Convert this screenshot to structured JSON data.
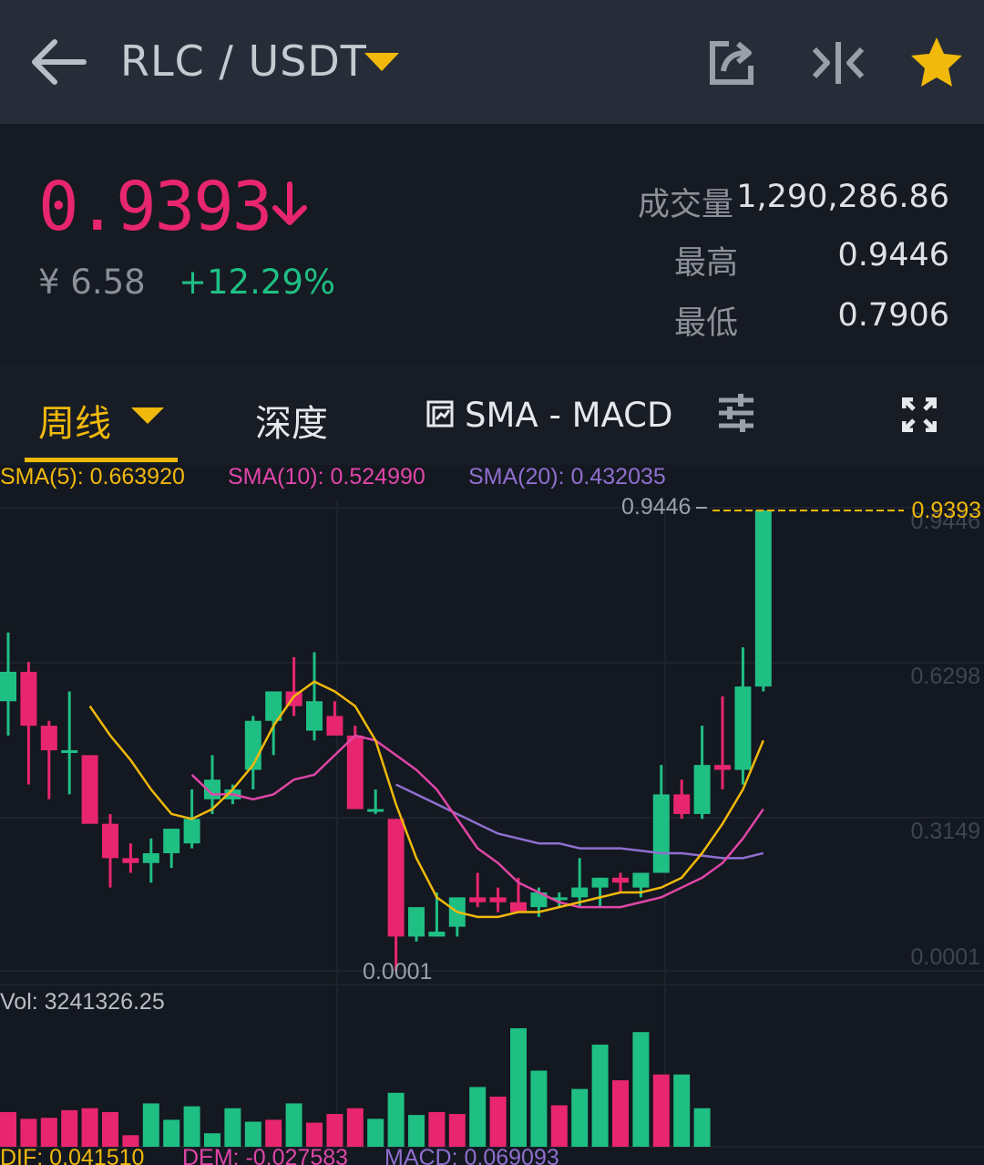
{
  "header": {
    "pair": "RLC / USDT",
    "icons": [
      "back-arrow-icon",
      "caret-down-icon",
      "share-icon",
      "compare-icon",
      "star-icon"
    ]
  },
  "ticker": {
    "price": "0.9393",
    "cny": "¥ 6.58",
    "change": "+12.29%",
    "volume_label": "成交量",
    "volume_value": "1,290,286.86",
    "high_label": "最高",
    "high_value": "0.9446",
    "low_label": "最低",
    "low_value": "0.7906"
  },
  "tabs": {
    "period": "周线",
    "depth": "深度",
    "indicator": "SMA - MACD"
  },
  "colors": {
    "up": "#1fbf84",
    "down": "#e8266f",
    "accent": "#f0b90b",
    "sma5": "#f0b90b",
    "sma10": "#e046a8",
    "sma20": "#8f6fcf"
  },
  "chart_data": {
    "type": "candlestick",
    "legend": {
      "sma5": "SMA(5): 0.663920",
      "sma10": "SMA(10): 0.524990",
      "sma20": "SMA(20): 0.432035"
    },
    "y_ticks": [
      "0.9446",
      "0.6298",
      "0.3149",
      "0.0001"
    ],
    "ylim": [
      0.0001,
      0.9446
    ],
    "max_label": "0.9446",
    "min_label": "0.0001",
    "last_price_label": "0.9393",
    "candles": [
      {
        "o": 0.55,
        "h": 0.69,
        "l": 0.48,
        "c": 0.61
      },
      {
        "o": 0.61,
        "h": 0.63,
        "l": 0.38,
        "c": 0.5
      },
      {
        "o": 0.5,
        "h": 0.51,
        "l": 0.35,
        "c": 0.45
      },
      {
        "o": 0.45,
        "h": 0.57,
        "l": 0.36,
        "c": 0.45
      },
      {
        "o": 0.44,
        "h": 0.44,
        "l": 0.32,
        "c": 0.3
      },
      {
        "o": 0.3,
        "h": 0.32,
        "l": 0.17,
        "c": 0.23
      },
      {
        "o": 0.23,
        "h": 0.26,
        "l": 0.2,
        "c": 0.22
      },
      {
        "o": 0.22,
        "h": 0.27,
        "l": 0.18,
        "c": 0.24
      },
      {
        "o": 0.24,
        "h": 0.29,
        "l": 0.21,
        "c": 0.29
      },
      {
        "o": 0.26,
        "h": 0.37,
        "l": 0.25,
        "c": 0.31
      },
      {
        "o": 0.35,
        "h": 0.44,
        "l": 0.32,
        "c": 0.39
      },
      {
        "o": 0.35,
        "h": 0.38,
        "l": 0.34,
        "c": 0.37
      },
      {
        "o": 0.41,
        "h": 0.52,
        "l": 0.37,
        "c": 0.51
      },
      {
        "o": 0.51,
        "h": 0.57,
        "l": 0.44,
        "c": 0.57
      },
      {
        "o": 0.57,
        "h": 0.64,
        "l": 0.52,
        "c": 0.54
      },
      {
        "o": 0.49,
        "h": 0.65,
        "l": 0.47,
        "c": 0.55
      },
      {
        "o": 0.52,
        "h": 0.55,
        "l": 0.48,
        "c": 0.48
      },
      {
        "o": 0.48,
        "h": 0.5,
        "l": 0.34,
        "c": 0.33
      },
      {
        "o": 0.33,
        "h": 0.37,
        "l": 0.32,
        "c": 0.33
      },
      {
        "o": 0.31,
        "h": 0.31,
        "l": 0.0001,
        "c": 0.07
      },
      {
        "o": 0.07,
        "h": 0.12,
        "l": 0.06,
        "c": 0.13
      },
      {
        "o": 0.07,
        "h": 0.16,
        "l": 0.07,
        "c": 0.08
      },
      {
        "o": 0.09,
        "h": 0.15,
        "l": 0.07,
        "c": 0.15
      },
      {
        "o": 0.15,
        "h": 0.2,
        "l": 0.13,
        "c": 0.14
      },
      {
        "o": 0.15,
        "h": 0.17,
        "l": 0.12,
        "c": 0.14
      },
      {
        "o": 0.14,
        "h": 0.19,
        "l": 0.13,
        "c": 0.12
      },
      {
        "o": 0.13,
        "h": 0.17,
        "l": 0.11,
        "c": 0.16
      },
      {
        "o": 0.15,
        "h": 0.16,
        "l": 0.13,
        "c": 0.15
      },
      {
        "o": 0.15,
        "h": 0.23,
        "l": 0.13,
        "c": 0.17
      },
      {
        "o": 0.17,
        "h": 0.19,
        "l": 0.13,
        "c": 0.19
      },
      {
        "o": 0.19,
        "h": 0.2,
        "l": 0.16,
        "c": 0.18
      },
      {
        "o": 0.17,
        "h": 0.2,
        "l": 0.15,
        "c": 0.2
      },
      {
        "o": 0.2,
        "h": 0.42,
        "l": 0.2,
        "c": 0.36
      },
      {
        "o": 0.36,
        "h": 0.39,
        "l": 0.31,
        "c": 0.32
      },
      {
        "o": 0.32,
        "h": 0.5,
        "l": 0.31,
        "c": 0.42
      },
      {
        "o": 0.42,
        "h": 0.56,
        "l": 0.37,
        "c": 0.41
      },
      {
        "o": 0.41,
        "h": 0.66,
        "l": 0.38,
        "c": 0.58
      },
      {
        "o": 0.58,
        "h": 0.94,
        "l": 0.57,
        "c": 0.9393
      }
    ],
    "sma5": [
      null,
      null,
      null,
      null,
      0.54,
      0.48,
      0.43,
      0.37,
      0.32,
      0.31,
      0.33,
      0.37,
      0.42,
      0.5,
      0.56,
      0.59,
      0.57,
      0.54,
      0.47,
      0.34,
      0.23,
      0.15,
      0.12,
      0.11,
      0.11,
      0.12,
      0.12,
      0.13,
      0.14,
      0.15,
      0.16,
      0.16,
      0.17,
      0.19,
      0.24,
      0.3,
      0.37,
      0.47
    ],
    "sma10": [
      null,
      null,
      null,
      null,
      null,
      null,
      null,
      null,
      null,
      0.4,
      0.36,
      0.36,
      0.35,
      0.36,
      0.39,
      0.4,
      0.44,
      0.48,
      0.47,
      0.44,
      0.41,
      0.37,
      0.31,
      0.25,
      0.22,
      0.18,
      0.16,
      0.14,
      0.13,
      0.13,
      0.13,
      0.14,
      0.15,
      0.17,
      0.19,
      0.22,
      0.27,
      0.33
    ],
    "sma20": [
      null,
      null,
      null,
      null,
      null,
      null,
      null,
      null,
      null,
      null,
      null,
      null,
      null,
      null,
      null,
      null,
      null,
      null,
      null,
      0.38,
      0.36,
      0.34,
      0.32,
      0.3,
      0.28,
      0.27,
      0.26,
      0.26,
      0.25,
      0.25,
      0.25,
      0.245,
      0.24,
      0.24,
      0.235,
      0.23,
      0.23,
      0.24
    ],
    "volume": {
      "label": "Vol: 3241326.25",
      "ylim": [
        0,
        140
      ],
      "bars": [
        {
          "v": 36,
          "up": false
        },
        {
          "v": 29,
          "up": false
        },
        {
          "v": 30,
          "up": false
        },
        {
          "v": 38,
          "up": false
        },
        {
          "v": 40,
          "up": false
        },
        {
          "v": 36,
          "up": false
        },
        {
          "v": 12,
          "up": false
        },
        {
          "v": 45,
          "up": true
        },
        {
          "v": 28,
          "up": true
        },
        {
          "v": 42,
          "up": true
        },
        {
          "v": 14,
          "up": true
        },
        {
          "v": 40,
          "up": true
        },
        {
          "v": 26,
          "up": true
        },
        {
          "v": 28,
          "up": false
        },
        {
          "v": 45,
          "up": true
        },
        {
          "v": 25,
          "up": false
        },
        {
          "v": 34,
          "up": false
        },
        {
          "v": 40,
          "up": false
        },
        {
          "v": 29,
          "up": true
        },
        {
          "v": 56,
          "up": true
        },
        {
          "v": 33,
          "up": true
        },
        {
          "v": 36,
          "up": false
        },
        {
          "v": 34,
          "up": false
        },
        {
          "v": 62,
          "up": true
        },
        {
          "v": 52,
          "up": false
        },
        {
          "v": 123,
          "up": true
        },
        {
          "v": 79,
          "up": true
        },
        {
          "v": 43,
          "up": false
        },
        {
          "v": 60,
          "up": true
        },
        {
          "v": 106,
          "up": true
        },
        {
          "v": 69,
          "up": false
        },
        {
          "v": 119,
          "up": true
        },
        {
          "v": 75,
          "up": false
        },
        {
          "v": 75,
          "up": true
        },
        {
          "v": 40,
          "up": true
        }
      ]
    },
    "macd": {
      "dif": "DIF: 0.041510",
      "dem": "DEM: -0.027583",
      "macd": "MACD: 0.069093"
    }
  }
}
